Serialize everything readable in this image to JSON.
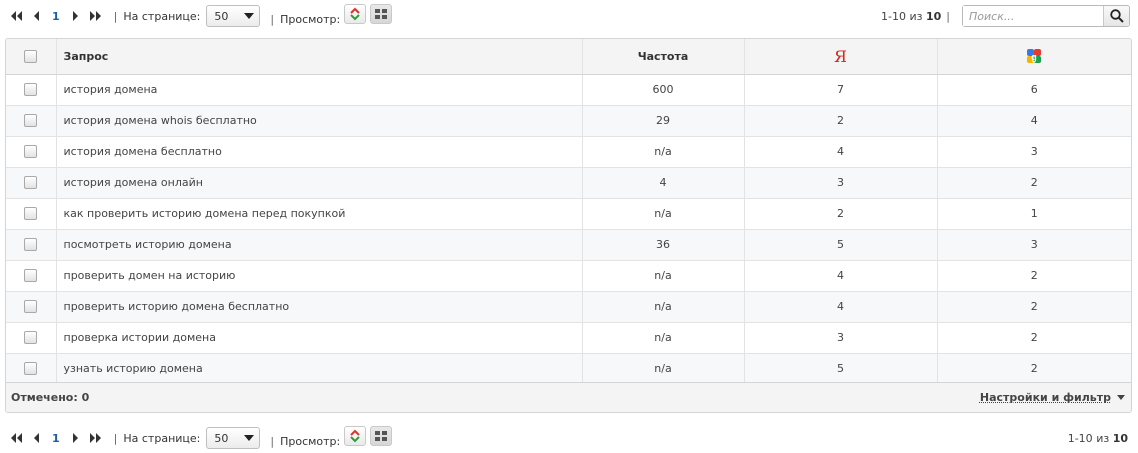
{
  "toolbar": {
    "page": "1",
    "per_page_label": "На странице:",
    "per_page_value": "50",
    "view_label": "Просмотр:",
    "range": "1-10",
    "of": "из",
    "total": "10",
    "search_placeholder": "Поиск..."
  },
  "table": {
    "headers": {
      "query": "Запрос",
      "frequency": "Частота",
      "yandex": "Я"
    },
    "rows": [
      {
        "query": "история домена",
        "freq": "600",
        "y": "7",
        "g": "6"
      },
      {
        "query": "история домена whois бесплатно",
        "freq": "29",
        "y": "2",
        "g": "4"
      },
      {
        "query": "история домена бесплатно",
        "freq": "n/a",
        "y": "4",
        "g": "3"
      },
      {
        "query": "история домена онлайн",
        "freq": "4",
        "y": "3",
        "g": "2"
      },
      {
        "query": "как проверить историю домена перед покупкой",
        "freq": "n/a",
        "y": "2",
        "g": "1"
      },
      {
        "query": "посмотреть историю домена",
        "freq": "36",
        "y": "5",
        "g": "3"
      },
      {
        "query": "проверить домен на историю",
        "freq": "n/a",
        "y": "4",
        "g": "2"
      },
      {
        "query": "проверить историю домена бесплатно",
        "freq": "n/a",
        "y": "4",
        "g": "2"
      },
      {
        "query": "проверка истории домена",
        "freq": "n/a",
        "y": "3",
        "g": "2"
      },
      {
        "query": "узнать историю домена",
        "freq": "n/a",
        "y": "5",
        "g": "2"
      }
    ]
  },
  "footer": {
    "marked": "Отмечено: 0",
    "settings": "Настройки и фильтр"
  },
  "colors": {
    "page_link": "#1a5ea8",
    "yandex_red": "#d52b1e",
    "header_bg": "#f4f4f4",
    "row_alt": "#f6f8fa"
  },
  "icons": [
    "first-page-icon",
    "prev-page-icon",
    "next-page-icon",
    "last-page-icon",
    "expand-collapse-icon",
    "grid-view-icon",
    "search-icon",
    "google-icon",
    "checkbox"
  ]
}
